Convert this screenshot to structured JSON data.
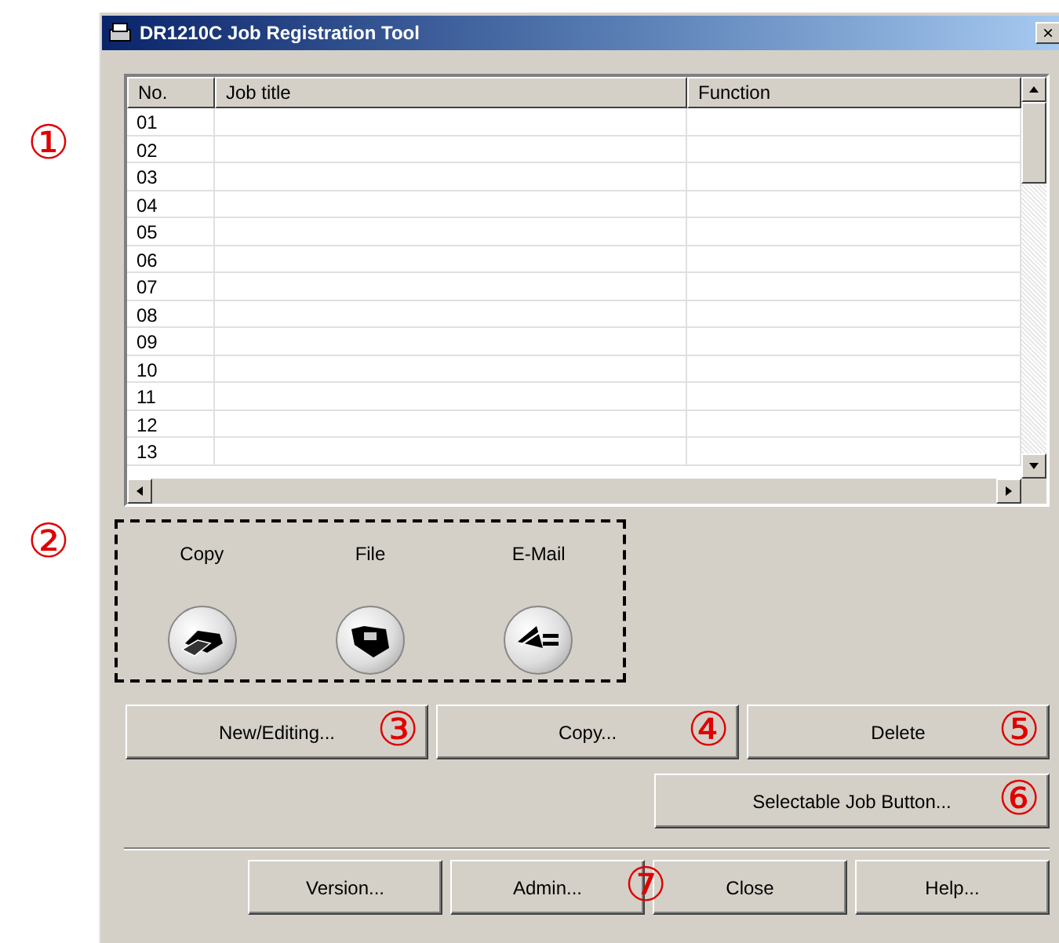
{
  "window": {
    "title": "DR1210C Job Registration Tool",
    "close": "×"
  },
  "callouts": {
    "table": "①",
    "job_buttons": "②"
  },
  "table": {
    "columns": [
      "No.",
      "Job title",
      "Function"
    ],
    "rows": [
      [
        "01",
        "",
        ""
      ],
      [
        "02",
        "",
        ""
      ],
      [
        "03",
        "",
        ""
      ],
      [
        "04",
        "",
        ""
      ],
      [
        "05",
        "",
        ""
      ],
      [
        "06",
        "",
        ""
      ],
      [
        "07",
        "",
        ""
      ],
      [
        "08",
        "",
        ""
      ],
      [
        "09",
        "",
        ""
      ],
      [
        "10",
        "",
        ""
      ],
      [
        "11",
        "",
        ""
      ],
      [
        "12",
        "",
        ""
      ],
      [
        "13",
        "",
        ""
      ]
    ]
  },
  "job_buttons": [
    {
      "label": "Copy",
      "kind": "copy"
    },
    {
      "label": "File",
      "kind": "file"
    },
    {
      "label": "E-Mail",
      "kind": "email"
    }
  ],
  "action_buttons": [
    {
      "label": "New/Editing...",
      "callout": "③"
    },
    {
      "label": "Copy...",
      "callout": "④"
    },
    {
      "label": "Delete",
      "callout": "⑤"
    }
  ],
  "selectable_button": {
    "label": "Selectable Job Button...",
    "callout": "⑥"
  },
  "bottom_buttons": [
    {
      "label": "Version..."
    },
    {
      "label": "Admin...",
      "callout": "⑦"
    },
    {
      "label": "Close"
    },
    {
      "label": "Help..."
    }
  ]
}
